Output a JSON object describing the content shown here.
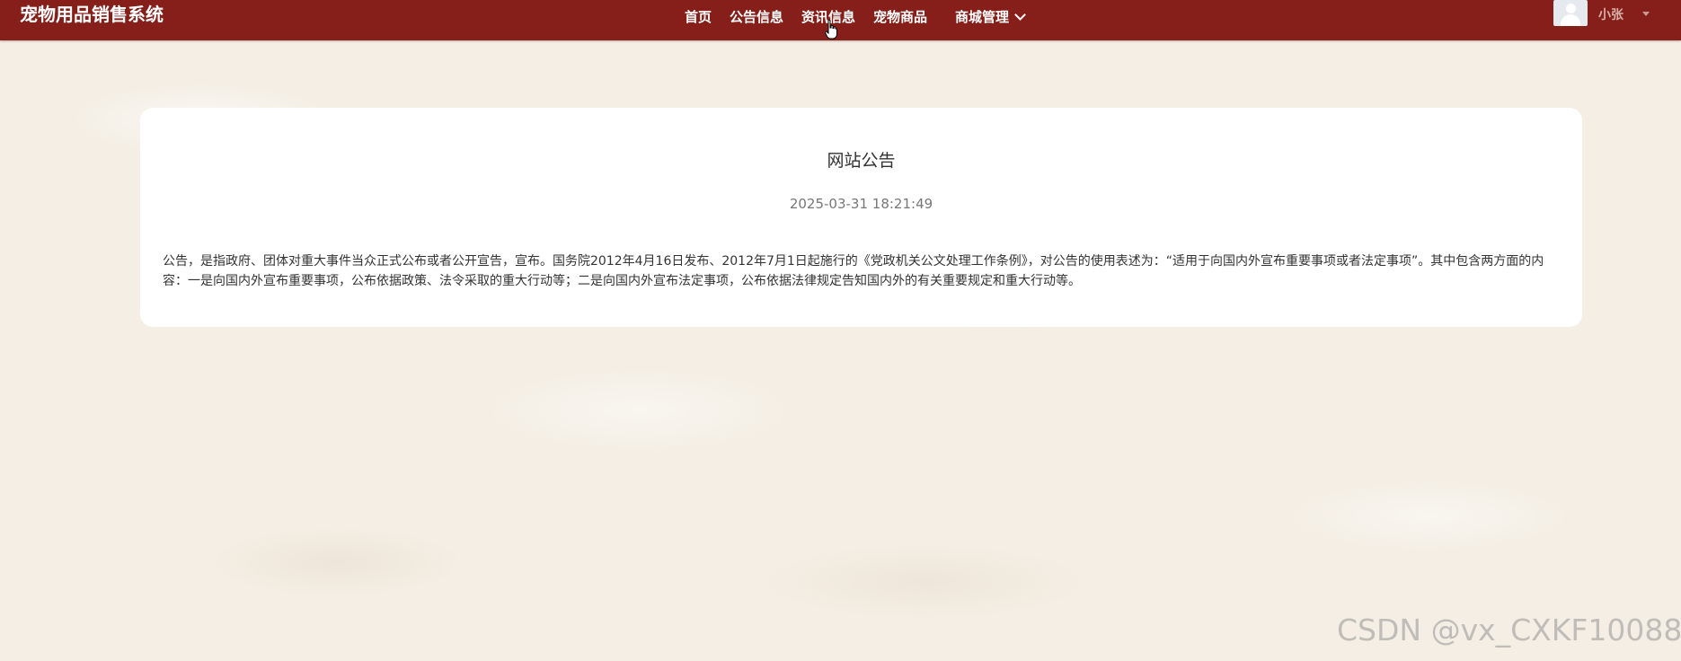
{
  "header": {
    "brand": "宠物用品销售系统",
    "nav": {
      "home": "首页",
      "notice": "公告信息",
      "news": "资讯信息",
      "goods": "宠物商品",
      "mall": "商城管理"
    },
    "user": {
      "name": "小张"
    },
    "colors": {
      "bar": "#861f1a"
    }
  },
  "notice": {
    "title": "网站公告",
    "date": "2025-03-31 18:21:49",
    "content": "公告，是指政府、团体对重大事件当众正式公布或者公开宣告，宣布。国务院2012年4月16日发布、2012年7月1日起施行的《党政机关公文处理工作条例》，对公告的使用表述为：“适用于向国内外宣布重要事项或者法定事项”。其中包含两方面的内容：一是向国内外宣布重要事项，公布依据政策、法令采取的重大行动等；二是向国内外宣布法定事项，公布依据法律规定告知国内外的有关重要规定和重大行动等。"
  },
  "watermark": "CSDN @vx_CXKF10088"
}
